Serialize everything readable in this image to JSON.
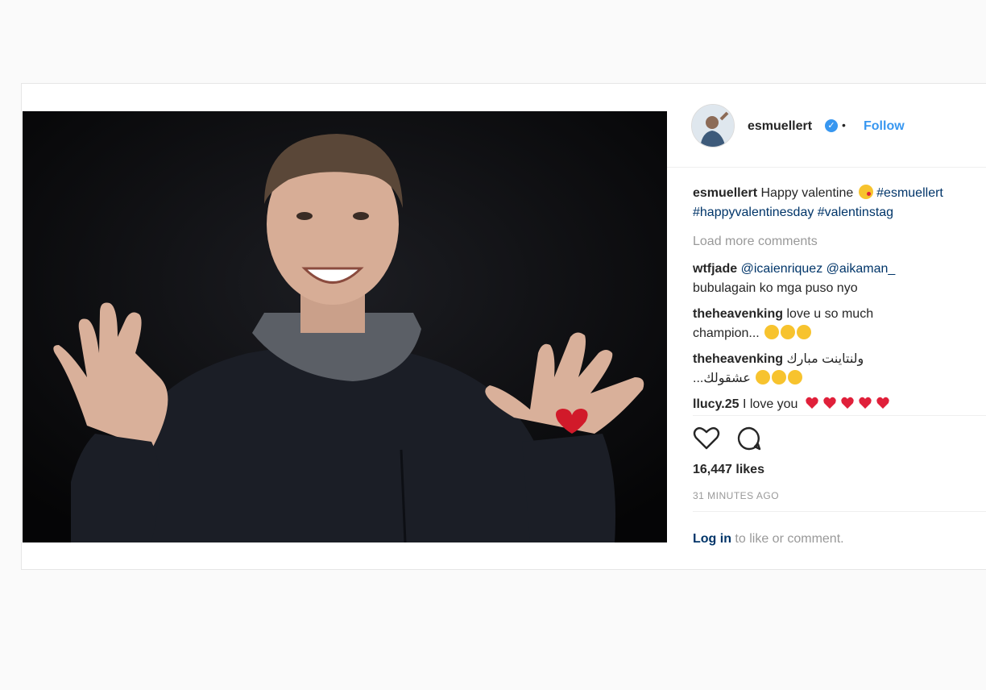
{
  "post": {
    "author": {
      "username": "esmuellert",
      "verified_icon": "verified-badge-icon",
      "separator": "•",
      "follow_label": "Follow"
    },
    "caption": {
      "username": "esmuellert",
      "text": "Happy valentine",
      "emoji": "kissing-face-icon",
      "tags_line1": "#esmuellert",
      "tags_line2": "#happyvalentinesday #valentinstag"
    },
    "load_more": "Load more comments",
    "comments": [
      {
        "username": "wtfjade",
        "text": "@icaienriquez @aikaman_",
        "text2": "bubulagain ko mga puso nyo"
      },
      {
        "username": "theheavenking",
        "text": "love u so much",
        "text2": "champion..."
      },
      {
        "username": "theheavenking",
        "text": "ولنتاينت مبارك",
        "text2": "...عشقولك"
      },
      {
        "username": "llucy.25",
        "text": "I love you"
      }
    ],
    "likes": "16,447 likes",
    "timestamp": "31 MINUTES AGO",
    "login": {
      "link": "Log in",
      "rest": " to like or comment."
    },
    "more_label": "..."
  },
  "colors": {
    "accent": "#3897f0",
    "link": "#003569",
    "muted": "#999999",
    "heart": "#e0203a"
  }
}
